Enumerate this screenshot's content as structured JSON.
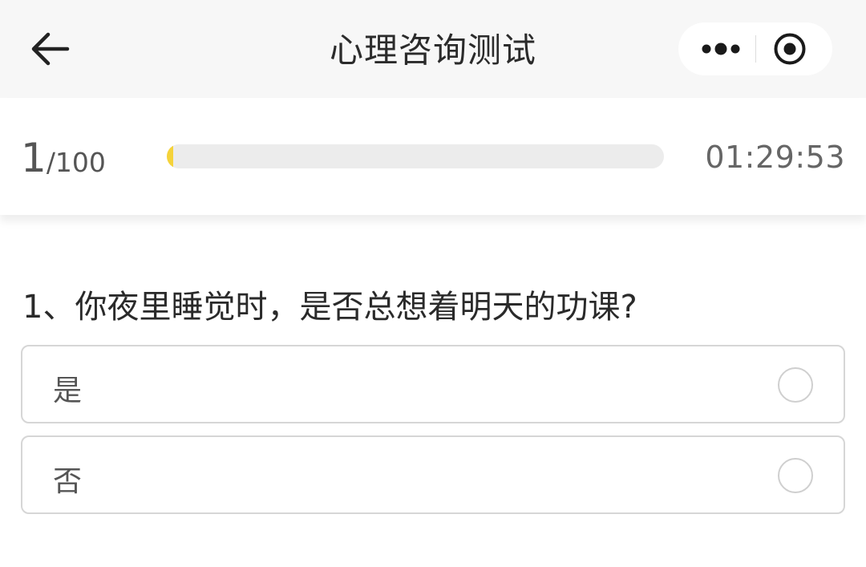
{
  "navbar": {
    "title": "心理咨询测试",
    "back_icon": "arrow-left-icon",
    "more_icon": "more-dots-icon",
    "close_icon": "target-close-icon"
  },
  "progress": {
    "current": "1",
    "total": "/100",
    "fraction": 0.01,
    "timer": "01:29:53",
    "accent_color": "#f5d33a"
  },
  "question": {
    "text": "1、你夜里睡觉时，是否总想着明天的功课?",
    "options": [
      {
        "label": "是",
        "selected": false
      },
      {
        "label": "否",
        "selected": false
      }
    ]
  }
}
